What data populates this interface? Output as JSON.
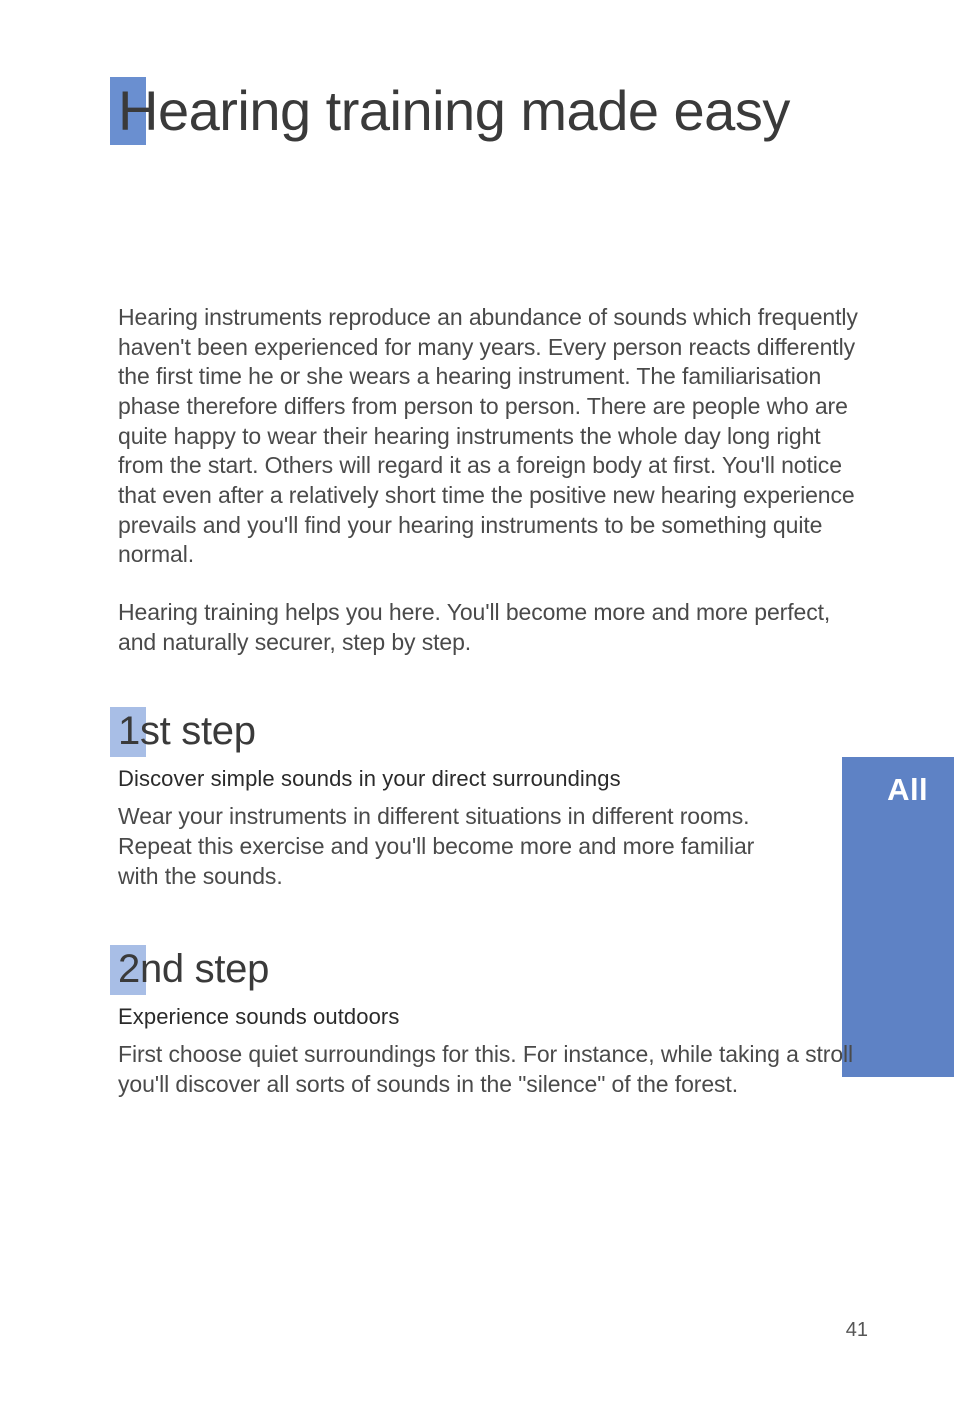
{
  "heading": "Hearing training made easy",
  "intro_paragraph_1": "Hearing instruments reproduce an abundance of sounds which frequently haven't been experienced for many years. Every person reacts differently the first time he or she wears a hearing instrument. The familiarisation phase therefore differs from person to person. There are people who are quite happy to wear their hearing instruments the whole day long right from the start. Others will regard it as a foreign body at first. You'll notice that even after a relatively short time the positive new hearing experience prevails and you'll find your hearing instruments to be something quite normal.",
  "intro_paragraph_2": "Hearing training helps you here. You'll become more and more perfect, and naturally securer, step by step.",
  "steps": [
    {
      "title": "1st step",
      "subtitle": "Discover simple sounds in your direct surroundings",
      "body": "Wear your instruments in different situations in different rooms. Repeat this exercise and you'll become more and more familiar with the sounds."
    },
    {
      "title": "2nd step",
      "subtitle": "Experience sounds outdoors",
      "body": "First choose quiet surroundings for this. For instance, while taking a stroll you'll discover all sorts of sounds in the \"silence\" of the forest."
    }
  ],
  "side_tab_label": "All",
  "page_number": "41"
}
